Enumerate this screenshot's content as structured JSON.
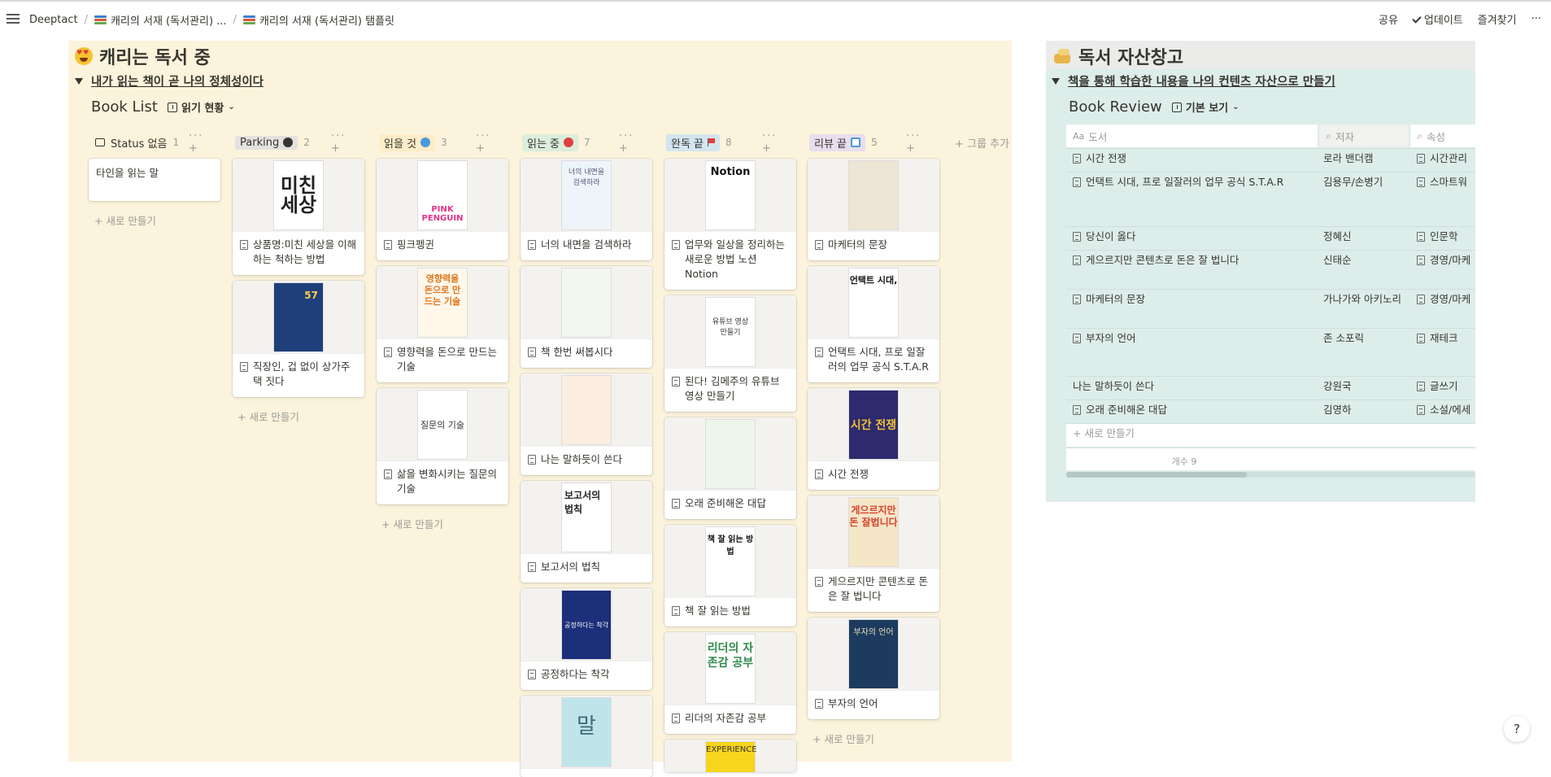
{
  "topbar": {
    "workspace": "Deeptact",
    "crumb1": "캐리의 서재 (독서관리) ...",
    "crumb2": "캐리의 서재 (독서관리) 탬플릿",
    "share": "공유",
    "updates": "업데이트",
    "favorites": "즐겨찾기",
    "more": "···"
  },
  "left": {
    "title": "캐리는 독서 중",
    "subtitle": "내가 읽는 책이 곧 나의 정체성이다",
    "view_title": "Book List",
    "view_tab": "읽기 현황",
    "add_group": "+ 그룹 추가",
    "new_label": "+ 새로 만들기",
    "columns": [
      {
        "name": "Status 없음",
        "count": "1",
        "tag_color": "",
        "dot": ""
      },
      {
        "name": "Parking",
        "count": "2",
        "tag_color": "#e3e2e0",
        "dot": "#373530"
      },
      {
        "name": "읽을 것",
        "count": "3",
        "tag_color": "#fdecc8",
        "dot": "#4a9ad9"
      },
      {
        "name": "읽는 중",
        "count": "7",
        "tag_color": "#dbeddb",
        "dot": "#e03e3e"
      },
      {
        "name": "완독 끝",
        "count": "8",
        "tag_color": "#d3e5ef",
        "dot": "#e03e3e"
      },
      {
        "name": "리뷰 끝",
        "count": "5",
        "tag_color": "#e8deee",
        "dot": "#4a9ad9"
      }
    ],
    "cards": {
      "c0": [
        "타인을 읽는 말"
      ],
      "c1": [
        "상품명:미친 세상을 이해하는 척하는 방법",
        "직장인, 겁 없이 상가주택 짓다"
      ],
      "c2": [
        "핑크펭귄",
        "영향력을 돈으로 만드는 기술",
        "삶을 변화시키는 질문의 기술"
      ],
      "c3": [
        "너의 내면을 검색하라",
        "책 한번 써봅시다",
        "나는 말하듯이 쓴다",
        "보고서의 법칙",
        "공정하다는 착각"
      ],
      "c4": [
        "업무와 일상을 정리하는 새로운 방법 노션 Notion",
        "된다! 김메주의 유튜브 영상 만들기",
        "오래 준비해온 대답",
        "책 잘 읽는 방법",
        "리더의 자존감 공부"
      ],
      "c5": [
        "마케터의 문장",
        "언택트 시대, 프로 일잘러의 업무 공식 S.T.A.R",
        "시간 전쟁",
        "게으르지만 콘텐츠로 돈은 잘 법니다",
        "부자의 언어"
      ]
    },
    "covers": {
      "c1_0": "미친세상",
      "c1_1": "57",
      "c2_0": "PINK PENGUIN",
      "c2_1": "영향력을 돈으로 만드는 기술",
      "c2_2": "질문의 기술",
      "c3_0": "너의 내면을 검색하라",
      "c3_3": "보고서의 법칙",
      "c3_4": "공정하다는 착각",
      "c3_5": "말",
      "c4_0": "Notion",
      "c4_1": "유튜브 영상 만들기",
      "c4_3": "책 잘 읽는 방법",
      "c4_4": "리더의 자존감 공부",
      "c4_5": "EXPERIENCE",
      "c5_1": "언택트 시대,",
      "c5_2": "시간 전쟁",
      "c5_3": "게으르지만 돈 잘법니다",
      "c5_4": "부자의 언어"
    }
  },
  "right": {
    "title": "독서 자산창고",
    "subtitle": "책을 통해 학습한 내용을 나의 컨텐츠 자산으로 만들기",
    "view_title": "Book Review",
    "view_tab": "기본 보기",
    "col_book": "도서",
    "col_author": "저자",
    "col_attr": "속성",
    "rows": [
      {
        "book": "시간 전쟁",
        "author": "로라 밴더캠",
        "attr": "시간관리",
        "page": true
      },
      {
        "book": "언택트 시대, 프로 일잘러의 업무 공식 S.T.A.R",
        "author": "김용무/손병기",
        "attr": "스마트워",
        "page": true
      },
      {
        "book": "당신이 옳다",
        "author": "정혜신",
        "attr": "인문학",
        "page": true
      },
      {
        "book": "게으르지만 콘텐츠로 돈은 잘 법니다",
        "author": "신태순",
        "attr": "경영/마케",
        "page": true
      },
      {
        "book": "마케터의 문장",
        "author": "가나가와 아키노리",
        "attr": "경영/마케",
        "page": true
      },
      {
        "book": "부자의 언어",
        "author": "존 소포릭",
        "attr": "재테크",
        "page": true
      },
      {
        "book": "나는 말하듯이 쓴다",
        "author": "강원국",
        "attr": "글쓰기",
        "page": false
      },
      {
        "book": "오래 준비해온 대답",
        "author": "김영하",
        "attr": "소설/에세",
        "page": true
      }
    ],
    "new_label": "+ 새로 만들기",
    "count_label": "개수 9"
  },
  "help": "?"
}
